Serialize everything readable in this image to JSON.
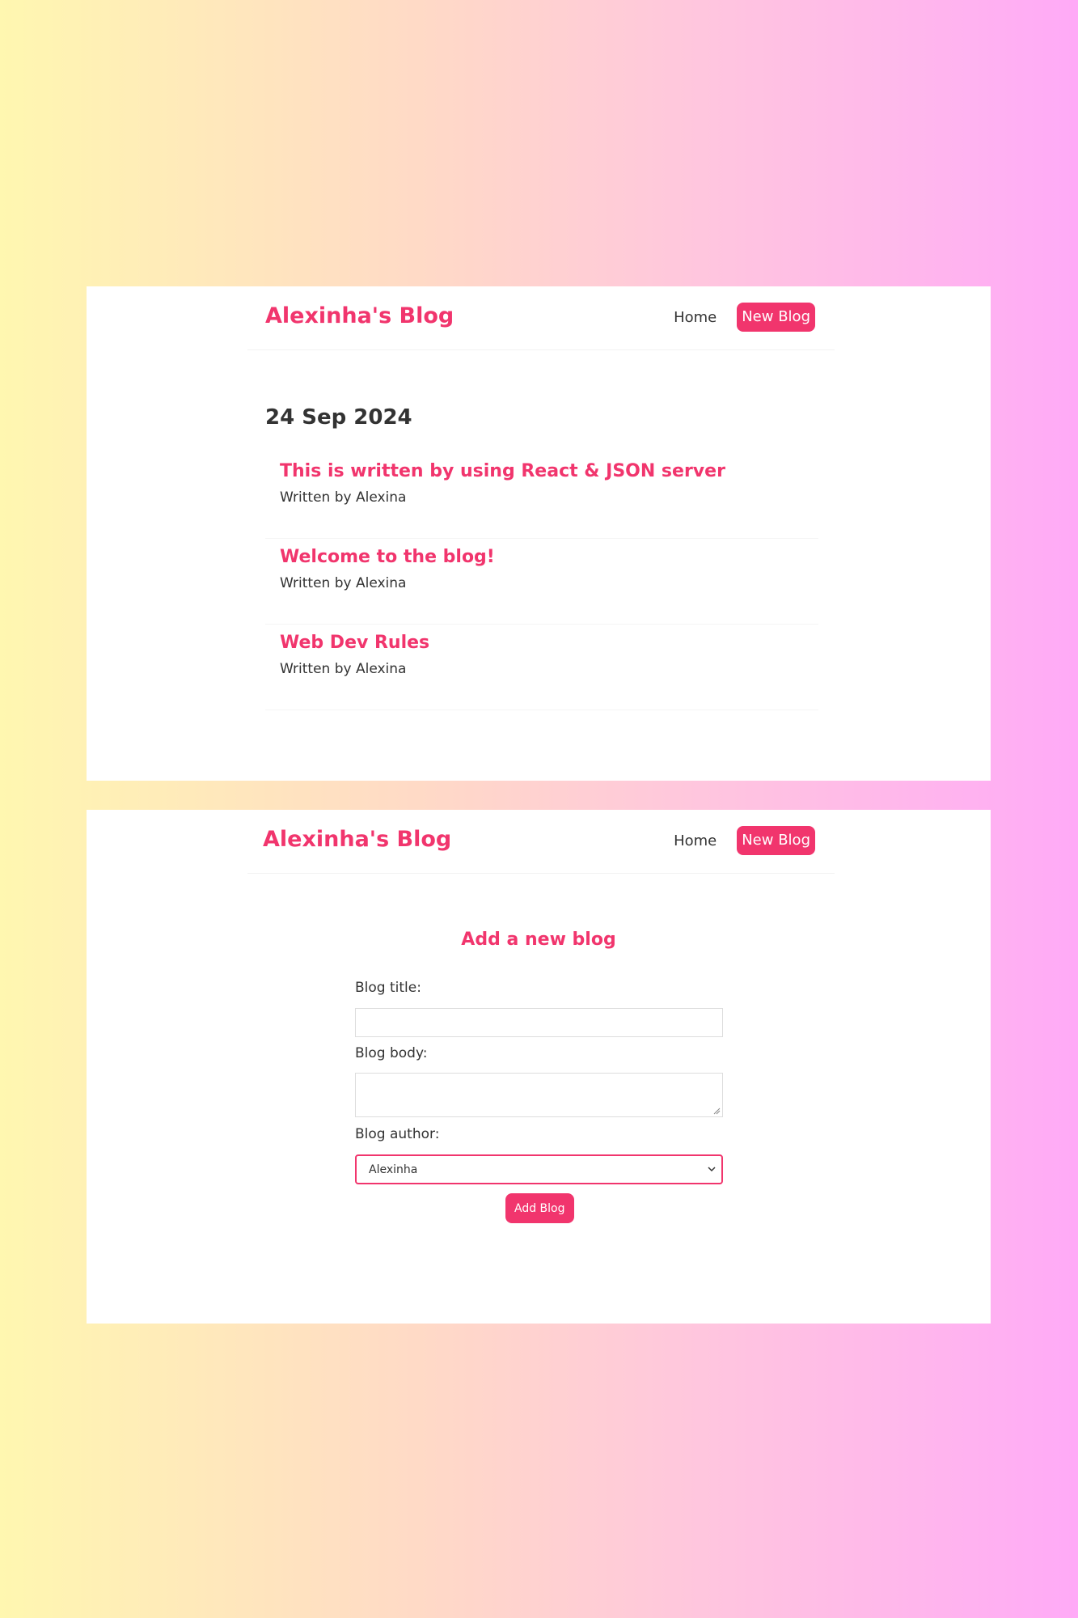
{
  "colors": {
    "accent": "#f1356d",
    "text": "#333333",
    "panel": "#ffffff"
  },
  "home_view": {
    "navbar": {
      "brand": "Alexinha's Blog",
      "home_link": "Home",
      "new_blog_link": "New Blog"
    },
    "date_heading": "24 Sep 2024",
    "blogs": [
      {
        "title": "This is written by using React & JSON server",
        "byline": "Written by Alexina"
      },
      {
        "title": "Welcome to the blog!",
        "byline": "Written by Alexina"
      },
      {
        "title": "Web Dev Rules",
        "byline": "Written by Alexina"
      }
    ]
  },
  "create_view": {
    "navbar": {
      "brand": "Alexinha's Blog",
      "home_link": "Home",
      "new_blog_link": "New Blog"
    },
    "heading": "Add a new blog",
    "form": {
      "title_label": "Blog title:",
      "title_value": "",
      "body_label": "Blog body:",
      "body_value": "",
      "author_label": "Blog author:",
      "author_selected": "Alexinha",
      "author_icon": "chevron-down-icon",
      "submit_label": "Add Blog"
    }
  }
}
